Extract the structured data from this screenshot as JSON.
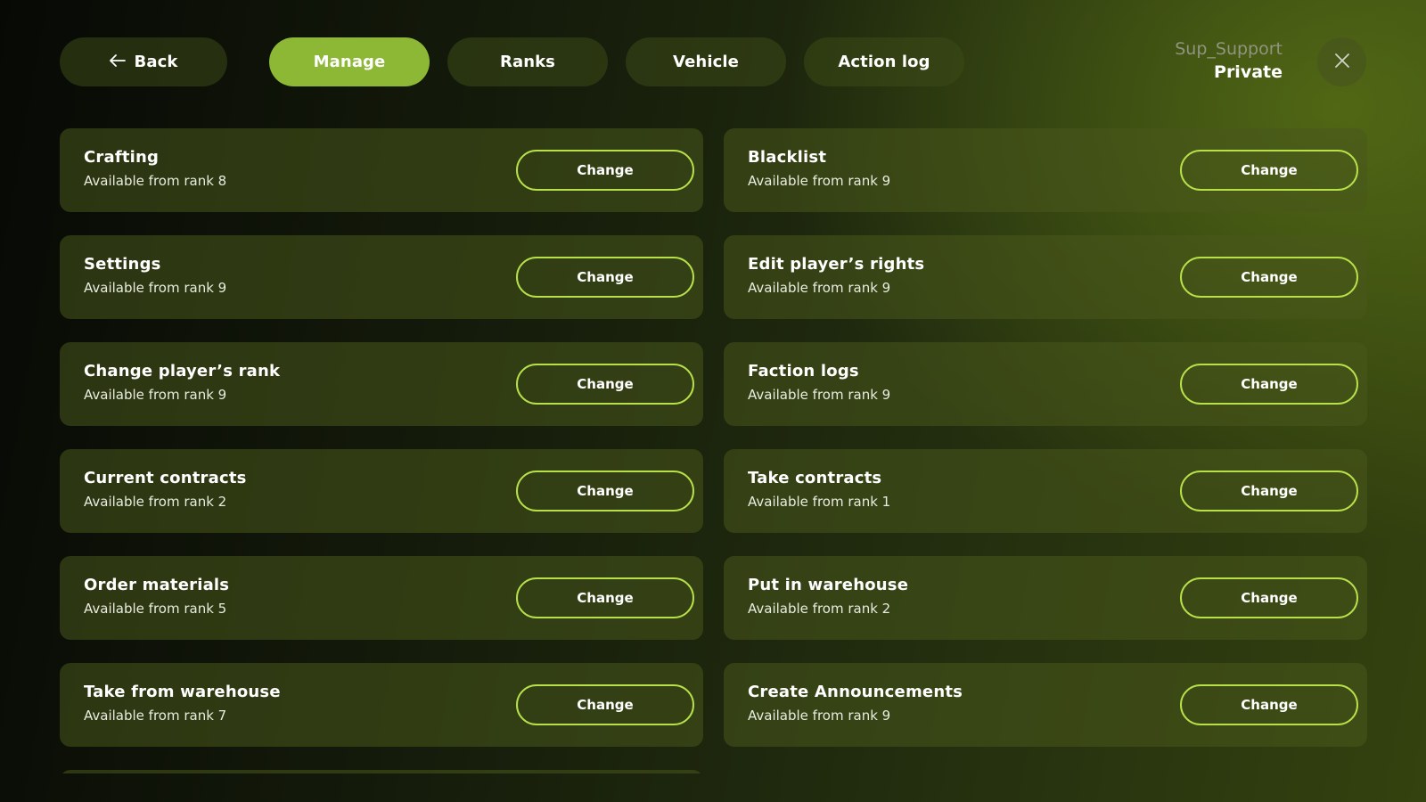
{
  "nav": {
    "back_label": "Back",
    "tabs": [
      {
        "label": "Manage",
        "active": true
      },
      {
        "label": "Ranks",
        "active": false
      },
      {
        "label": "Vehicle",
        "active": false
      },
      {
        "label": "Action log",
        "active": false
      }
    ]
  },
  "user": {
    "name": "Sup_Support",
    "rank": "Private"
  },
  "colors": {
    "accent": "#8cb835",
    "button_border": "#b8e04a"
  },
  "icons": {
    "back": "arrow-left-icon",
    "close": "close-icon"
  },
  "permissions": [
    {
      "title": "Crafting",
      "subtitle": "Available from rank 8",
      "button": "Change"
    },
    {
      "title": "Blacklist",
      "subtitle": "Available from rank 9",
      "button": "Change"
    },
    {
      "title": "Settings",
      "subtitle": "Available from rank 9",
      "button": "Change"
    },
    {
      "title": "Edit player’s rights",
      "subtitle": "Available from rank 9",
      "button": "Change"
    },
    {
      "title": "Change player’s rank",
      "subtitle": "Available from rank 9",
      "button": "Change"
    },
    {
      "title": "Faction logs",
      "subtitle": "Available from rank 9",
      "button": "Change"
    },
    {
      "title": "Current contracts",
      "subtitle": "Available from rank 2",
      "button": "Change"
    },
    {
      "title": "Take contracts",
      "subtitle": "Available from rank 1",
      "button": "Change"
    },
    {
      "title": "Order materials",
      "subtitle": "Available from rank 5",
      "button": "Change"
    },
    {
      "title": "Put in warehouse",
      "subtitle": "Available from rank 2",
      "button": "Change"
    },
    {
      "title": "Take from warehouse",
      "subtitle": "Available from rank 7",
      "button": "Change"
    },
    {
      "title": "Create Announcements",
      "subtitle": "Available from rank 9",
      "button": "Change"
    }
  ]
}
